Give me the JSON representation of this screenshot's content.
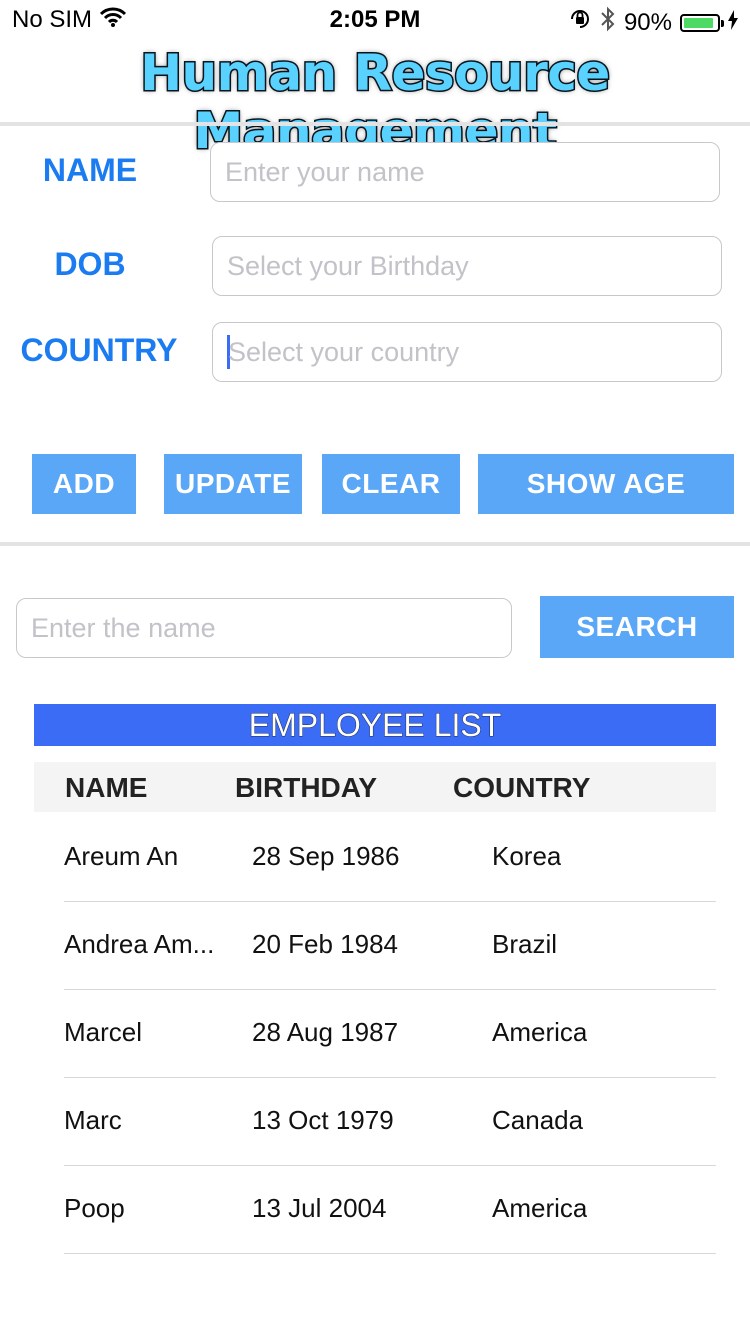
{
  "status_bar": {
    "carrier": "No SIM",
    "time": "2:05 PM",
    "battery_percent": "90%",
    "battery_level": 0.9
  },
  "app": {
    "title": "Human Resource Management"
  },
  "form": {
    "name_label": "NAME",
    "name_placeholder": "Enter your name",
    "dob_label": "DOB",
    "dob_placeholder": "Select your Birthday",
    "country_label": "COUNTRY",
    "country_placeholder": "Select your country"
  },
  "buttons": {
    "add": "ADD",
    "update": "UPDATE",
    "clear": "CLEAR",
    "show_age": "SHOW AGE"
  },
  "search": {
    "placeholder": "Enter the name",
    "button": "SEARCH"
  },
  "employee_list": {
    "title": "EMPLOYEE LIST",
    "columns": [
      "NAME",
      "BIRTHDAY",
      "COUNTRY"
    ],
    "rows": [
      {
        "name": "Areum An",
        "birthday": "28 Sep 1986",
        "country": "Korea"
      },
      {
        "name": "Andrea Am...",
        "birthday": "20 Feb 1984",
        "country": "Brazil"
      },
      {
        "name": "Marcel",
        "birthday": "28 Aug 1987",
        "country": "America"
      },
      {
        "name": "Marc",
        "birthday": "13 Oct 1979",
        "country": "Canada"
      },
      {
        "name": "Poop",
        "birthday": "13 Jul 2004",
        "country": "America"
      }
    ]
  },
  "colors": {
    "label_blue": "#1a7cf0",
    "button_blue": "#5aa7f7",
    "list_title_blue": "#3b6cf6",
    "battery_green": "#4cd964"
  },
  "icons": [
    "wifi-icon",
    "orientation-lock-icon",
    "bluetooth-icon",
    "battery-icon",
    "charging-bolt-icon"
  ]
}
